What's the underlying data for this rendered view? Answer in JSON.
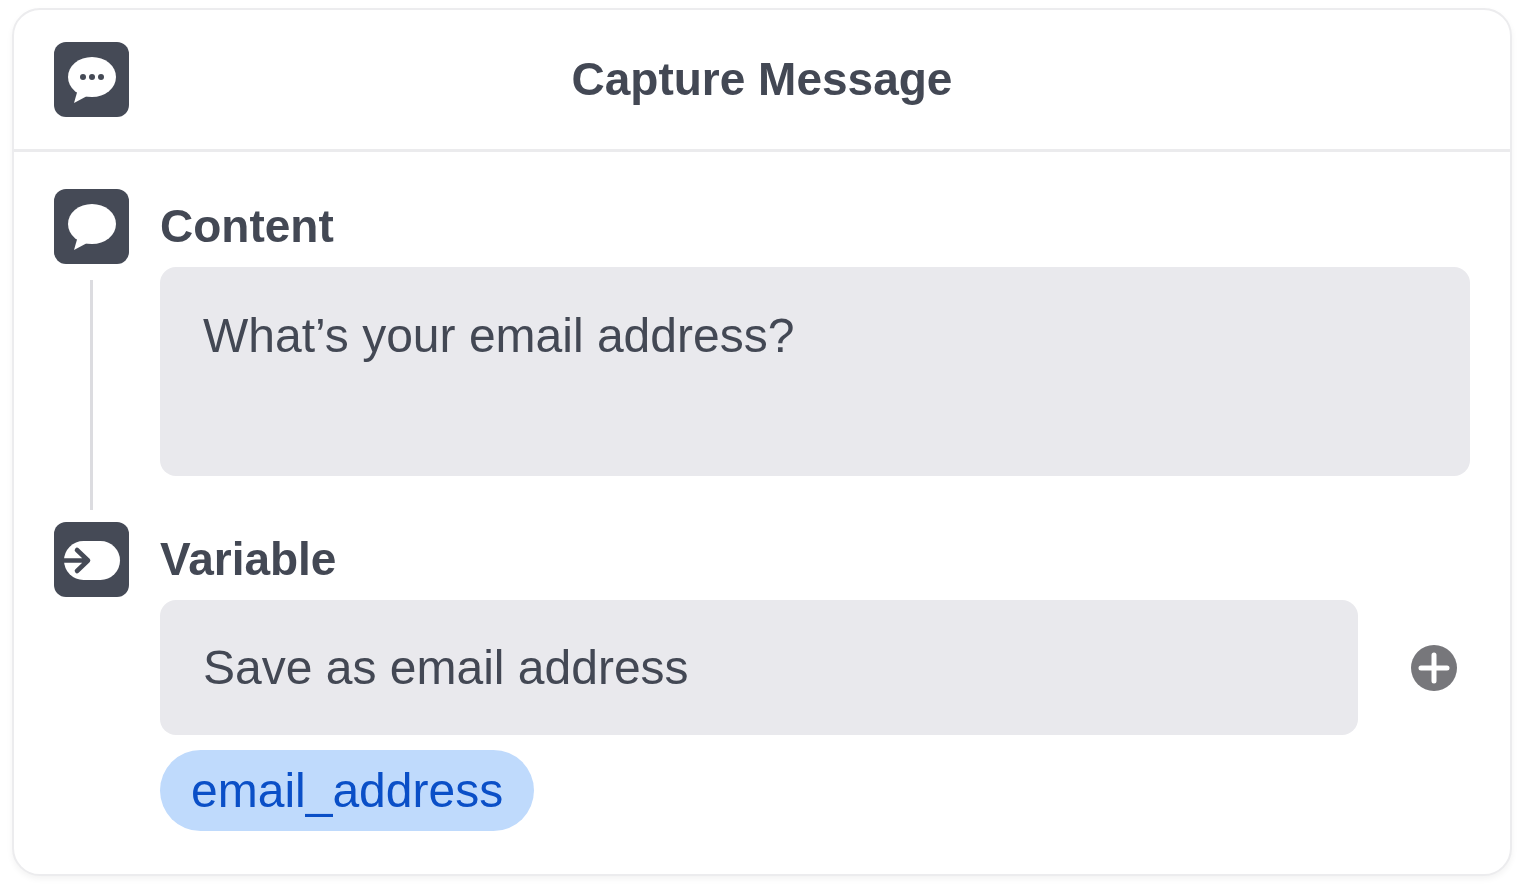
{
  "header": {
    "title": "Capture Message"
  },
  "sections": [
    {
      "kind": "content",
      "label": "Content",
      "value": "What’s your email address?"
    },
    {
      "kind": "variable",
      "label": "Variable",
      "value": "Save as email address",
      "chips": [
        {
          "label": "email_address"
        }
      ]
    }
  ]
}
